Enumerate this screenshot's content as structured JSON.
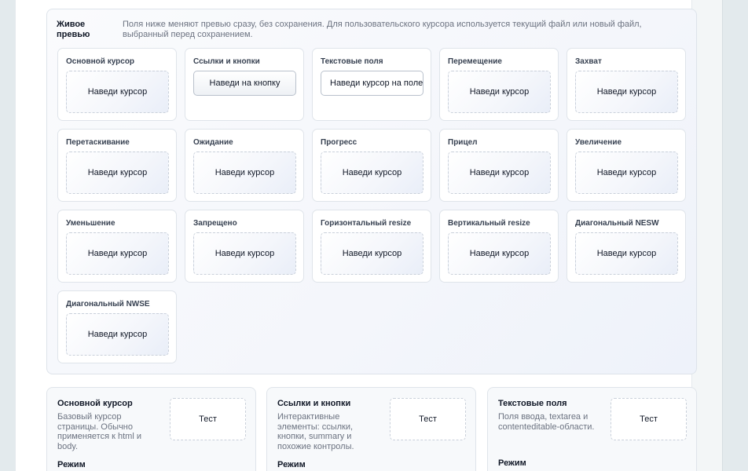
{
  "preview": {
    "title": "Живое превью",
    "description": "Поля ниже меняют превью сразу, без сохранения. Для пользовательского курсора используется текущий файл или новый файл, выбранный перед сохранением.",
    "items": [
      {
        "label": "Основной курсор",
        "kind": "zone",
        "text": "Наведи курсор"
      },
      {
        "label": "Ссылки и кнопки",
        "kind": "button",
        "text": "Наведи на кнопку"
      },
      {
        "label": "Текстовые поля",
        "kind": "input",
        "text": "Наведи курсор на поле"
      },
      {
        "label": "Перемещение",
        "kind": "zone",
        "text": "Наведи курсор"
      },
      {
        "label": "Захват",
        "kind": "zone",
        "text": "Наведи курсор"
      },
      {
        "label": "Перетаскивание",
        "kind": "zone",
        "text": "Наведи курсор"
      },
      {
        "label": "Ожидание",
        "kind": "zone",
        "text": "Наведи курсор"
      },
      {
        "label": "Прогресс",
        "kind": "zone",
        "text": "Наведи курсор"
      },
      {
        "label": "Прицел",
        "kind": "zone",
        "text": "Наведи курсор"
      },
      {
        "label": "Увеличение",
        "kind": "zone",
        "text": "Наведи курсор"
      },
      {
        "label": "Уменьшение",
        "kind": "zone",
        "text": "Наведи курсор"
      },
      {
        "label": "Запрещено",
        "kind": "zone",
        "text": "Наведи курсор"
      },
      {
        "label": "Горизонтальный resize",
        "kind": "zone",
        "text": "Наведи курсор"
      },
      {
        "label": "Вертикальный resize",
        "kind": "zone",
        "text": "Наведи курсор"
      },
      {
        "label": "Диагональный NESW",
        "kind": "zone",
        "text": "Наведи курсор"
      },
      {
        "label": "Диагональный NWSE",
        "kind": "zone",
        "text": "Наведи курсор"
      }
    ]
  },
  "cards": [
    {
      "title": "Основной курсор",
      "description": "Базовый курсор страницы. Обычно применяется к html и body.",
      "test_label": "Тест",
      "mode_label": "Режим"
    },
    {
      "title": "Ссылки и кнопки",
      "description": "Интерактивные элементы: ссылки, кнопки, summary и похожие контролы.",
      "test_label": "Тест",
      "mode_label": "Режим"
    },
    {
      "title": "Текстовые поля",
      "description": "Поля ввода, textarea и contenteditable-области.",
      "test_label": "Тест",
      "mode_label": "Режим"
    }
  ]
}
